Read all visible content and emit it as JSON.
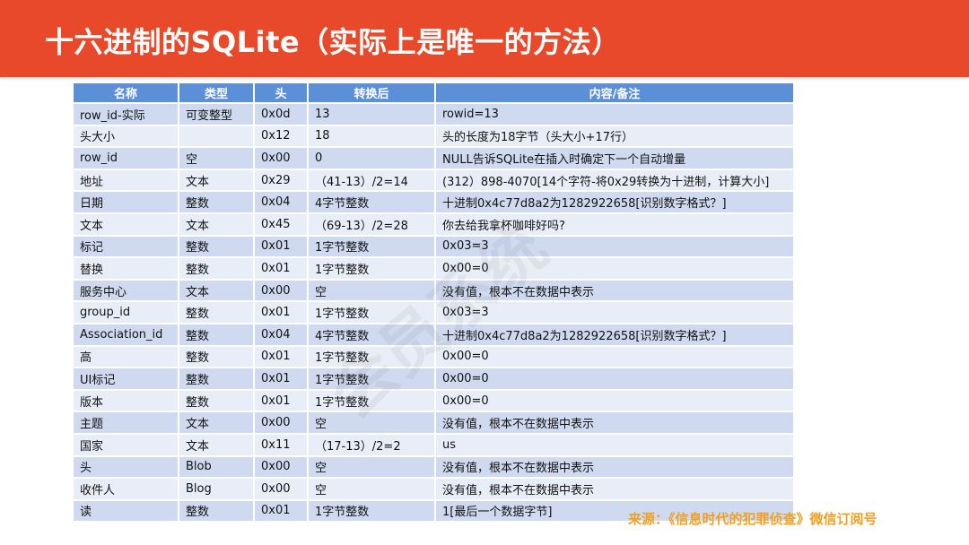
{
  "slide": {
    "title": "十六进制的SQLite（实际上是唯一的方法）",
    "source_note": "来源：《信息时代的犯罪侦查》微信订阅号"
  },
  "table": {
    "headers": [
      "名称",
      "类型",
      "头",
      "转换后",
      "内容/备注"
    ],
    "rows": [
      [
        "row_id-实际",
        "可变整型",
        "0x0d",
        "13",
        "rowid=13"
      ],
      [
        "头大小",
        "",
        "0x12",
        "18",
        "头的长度为18字节（头大小+17行）"
      ],
      [
        "row_id",
        "空",
        "0x00",
        "0",
        "NULL告诉SQLite在插入时确定下一个自动增量"
      ],
      [
        "地址",
        "文本",
        "0x29",
        "（41-13）/2=14",
        "(312）898-4070[14个字符-将0x29转换为十进制，计算大小]"
      ],
      [
        "日期",
        "整数",
        "0x04",
        "4字节整数",
        "十进制0x4c77d8a2为1282922658[识别数字格式？]"
      ],
      [
        "文本",
        "文本",
        "0x45",
        "（69-13）/2=28",
        "你去给我拿杯咖啡好吗?"
      ],
      [
        "标记",
        "整数",
        "0x01",
        "1字节整数",
        "0x03=3"
      ],
      [
        "替换",
        "整数",
        "0x01",
        "1字节整数",
        "0x00=0"
      ],
      [
        "服务中心",
        "文本",
        "0x00",
        "空",
        "没有值，根本不在数据中表示"
      ],
      [
        "group_id",
        "整数",
        "0x01",
        "1字节整数",
        "0x03=3"
      ],
      [
        "Association_id",
        "整数",
        "0x04",
        "4字节整数",
        "十进制0x4c77d8a2为1282922658[识别数字格式？]"
      ],
      [
        "高",
        "整数",
        "0x01",
        "1字节整数",
        "0x00=0"
      ],
      [
        "UI标记",
        "整数",
        "0x01",
        "1字节整数",
        "0x00=0"
      ],
      [
        "版本",
        "整数",
        "0x01",
        "1字节整数",
        "0x00=0"
      ],
      [
        "主题",
        "文本",
        "0x00",
        "空",
        "没有值，根本不在数据中表示"
      ],
      [
        "国家",
        "文本",
        "0x11",
        "（17-13）/2=2",
        "us"
      ],
      [
        "头",
        "Blob",
        "0x00",
        "空",
        "没有值，根本不在数据中表示"
      ],
      [
        "收件人",
        "Blog",
        "0x00",
        "空",
        "没有值，根本不在数据中表示"
      ],
      [
        "读",
        "整数",
        "0x01",
        "1字节整数",
        "1[最后一个数据字节]"
      ]
    ]
  },
  "colors": {
    "title_bar": "#e8492a",
    "header_row": "#5b8fd8",
    "row_odd": "#cfdaf0",
    "row_even": "#e8eef8",
    "source_note": "#f0a020"
  }
}
